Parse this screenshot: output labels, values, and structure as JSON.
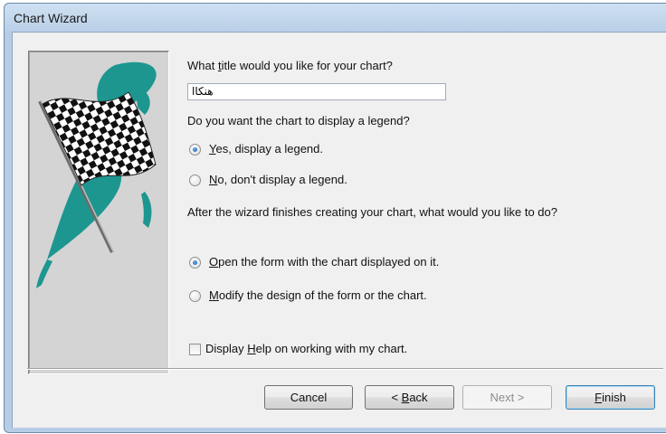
{
  "window": {
    "title": "Chart Wizard"
  },
  "title_question": {
    "label_before": "What ",
    "label_key": "t",
    "label_after": "itle would you like for your chart?",
    "input_value": "هنكاا"
  },
  "legend": {
    "question": "Do you want the chart to display a legend?",
    "yes": {
      "key": "Y",
      "rest": "es, display a legend.",
      "selected": true
    },
    "no": {
      "key": "N",
      "rest": "o, don't display a legend.",
      "selected": false
    }
  },
  "after": {
    "question": "After the wizard finishes creating your chart, what would you like to do?",
    "open": {
      "key": "O",
      "rest": "pen the form with the chart displayed on it.",
      "selected": true
    },
    "modify": {
      "key": "M",
      "rest": "odify the design of the form or the chart.",
      "selected": false
    }
  },
  "help_checkbox": {
    "before": "Display ",
    "key": "H",
    "after": "elp on working with my chart.",
    "checked": false
  },
  "buttons": {
    "cancel": "Cancel",
    "back_prefix": "< ",
    "back_key": "B",
    "back_rest": "ack",
    "next": "Next >",
    "finish_key": "F",
    "finish_rest": "inish"
  },
  "colors": {
    "teal_accent": "#1d9690",
    "selected_radio": "#1a5fa8",
    "title_bar": "#b9cfe7"
  },
  "icons": {
    "wizard_art": "checkered-flag-icon"
  }
}
